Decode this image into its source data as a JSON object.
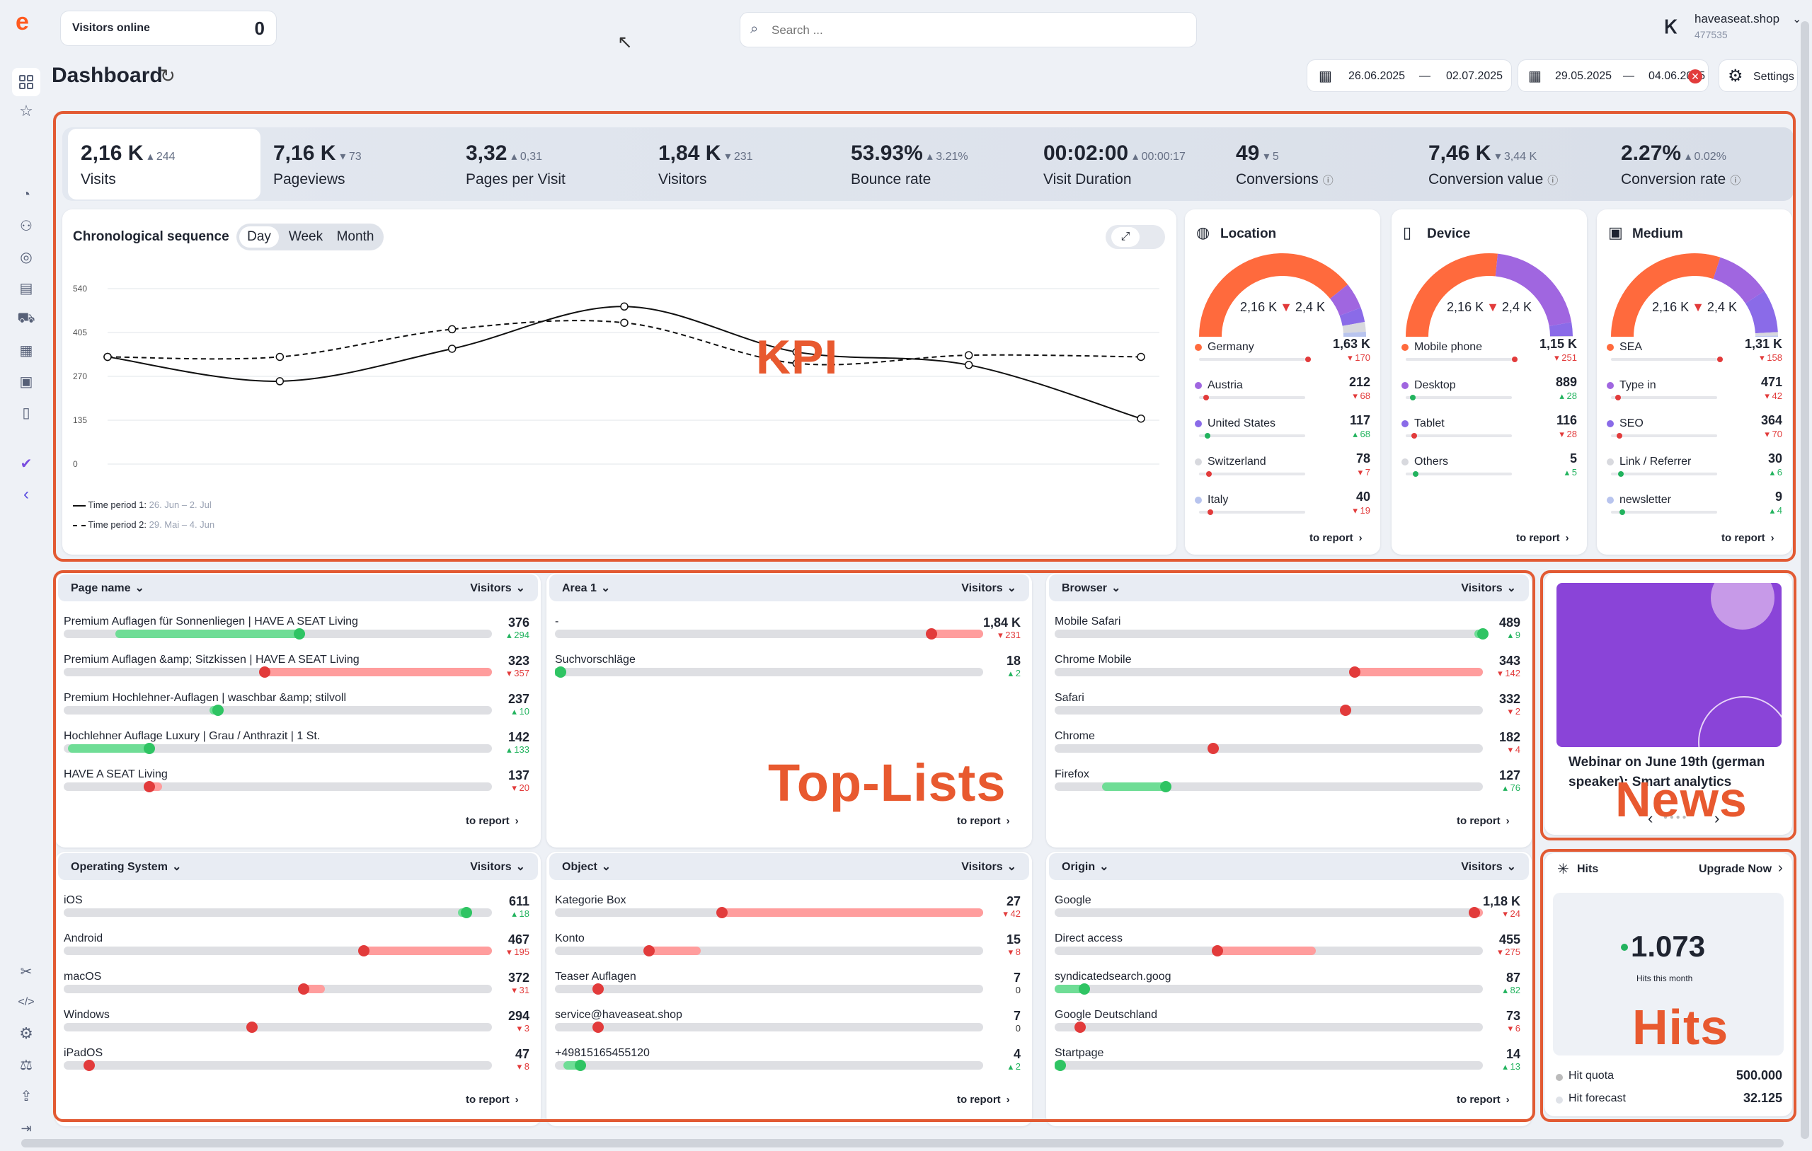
{
  "brand": {
    "logo": "e"
  },
  "header": {
    "visitors_online_label": "Visitors online",
    "visitors_online_value": "0",
    "search_placeholder": "Search ...",
    "shop_name": "haveaseat.shop",
    "shop_id": "477535",
    "title": "Dashboard",
    "period1_start": "26.06.2025",
    "period1_sep": "—",
    "period1_end": "02.07.2025",
    "period2_start": "29.05.2025",
    "period2_sep": "—",
    "period2_end": "04.06.2025",
    "settings_label": "Settings"
  },
  "kpis": [
    {
      "value": "2,16 K",
      "delta": "▴ 244",
      "dir": "up",
      "label": "Visits"
    },
    {
      "value": "7,16 K",
      "delta": "▾ 73",
      "dir": "dn",
      "label": "Pageviews"
    },
    {
      "value": "3,32",
      "delta": "▴ 0,31",
      "dir": "up",
      "label": "Pages per Visit"
    },
    {
      "value": "1,84 K",
      "delta": "▾ 231",
      "dir": "dn",
      "label": "Visitors"
    },
    {
      "value": "53.93%",
      "delta": "▴ 3.21%",
      "dir": "up",
      "label": "Bounce rate"
    },
    {
      "value": "00:02:00",
      "delta": "▴ 00:00:17",
      "dir": "up",
      "label": "Visit Duration"
    },
    {
      "value": "49",
      "delta": "▾ 5",
      "dir": "dn",
      "label": "Conversions"
    },
    {
      "value": "7,46 K",
      "delta": "▾ 3,44 K",
      "dir": "dn",
      "label": "Conversion value"
    },
    {
      "value": "2.27%",
      "delta": "▴ 0.02%",
      "dir": "up",
      "label": "Conversion rate"
    }
  ],
  "chronology": {
    "title": "Chronological sequence",
    "tabs": [
      "Day",
      "Week",
      "Month"
    ],
    "active_tab": "Day",
    "legend1": "Time period 1:",
    "legend1_range": "26. Jun – 2. Jul",
    "legend2": "Time period 2:",
    "legend2_range": "29. Mai – 4. Jun",
    "watermark": "KPI"
  },
  "chart_data": {
    "type": "line",
    "x": [
      "1",
      "2",
      "3",
      "4",
      "5",
      "6",
      "7"
    ],
    "ylim": [
      0,
      540
    ],
    "yticks": [
      "540",
      "405",
      "270",
      "135",
      "0"
    ],
    "series": [
      {
        "name": "Time period 1:",
        "style": "solid",
        "values": [
          330,
          255,
          355,
          485,
          345,
          305,
          140
        ]
      },
      {
        "name": "Time period 2:",
        "style": "dashed",
        "values": [
          330,
          330,
          415,
          435,
          310,
          335,
          330
        ]
      }
    ]
  },
  "donuts": [
    {
      "title": "Location",
      "icon": "globe-icon",
      "center": "2,16 K",
      "center_delta": "2,4 K",
      "items": [
        {
          "label": "Germany",
          "value": "1,63 K",
          "delta": "▾ 170",
          "dir": "dn",
          "color": "#ff6a3d"
        },
        {
          "label": "Austria",
          "value": "212",
          "delta": "▾ 68",
          "dir": "dn",
          "color": "#a066e0"
        },
        {
          "label": "United States",
          "value": "117",
          "delta": "▴ 68",
          "dir": "up",
          "color": "#8a6be8"
        },
        {
          "label": "Switzerland",
          "value": "78",
          "delta": "▾ 7",
          "dir": "dn",
          "color": "#d8d9de"
        },
        {
          "label": "Italy",
          "value": "40",
          "delta": "▾ 19",
          "dir": "dn",
          "color": "#b8c4ee"
        }
      ],
      "to_report": "to report"
    },
    {
      "title": "Device",
      "icon": "phone-icon",
      "center": "2,16 K",
      "center_delta": "2,4 K",
      "items": [
        {
          "label": "Mobile phone",
          "value": "1,15 K",
          "delta": "▾ 251",
          "dir": "dn",
          "color": "#ff6a3d"
        },
        {
          "label": "Desktop",
          "value": "889",
          "delta": "▴ 28",
          "dir": "up",
          "color": "#a066e0"
        },
        {
          "label": "Tablet",
          "value": "116",
          "delta": "▾ 28",
          "dir": "dn",
          "color": "#8a6be8"
        },
        {
          "label": "Others",
          "value": "5",
          "delta": "▴ 5",
          "dir": "up",
          "color": "#d8d9de"
        }
      ],
      "to_report": "to report"
    },
    {
      "title": "Medium",
      "icon": "medium-icon",
      "center": "2,16 K",
      "center_delta": "2,4 K",
      "items": [
        {
          "label": "SEA",
          "value": "1,31 K",
          "delta": "▾ 158",
          "dir": "dn",
          "color": "#ff6a3d"
        },
        {
          "label": "Type in",
          "value": "471",
          "delta": "▾ 42",
          "dir": "dn",
          "color": "#a066e0"
        },
        {
          "label": "SEO",
          "value": "364",
          "delta": "▾ 70",
          "dir": "dn",
          "color": "#8a6be8"
        },
        {
          "label": "Link / Referrer",
          "value": "30",
          "delta": "▴ 6",
          "dir": "up",
          "color": "#d8d9de"
        },
        {
          "label": "newsletter",
          "value": "9",
          "delta": "▴ 4",
          "dir": "up",
          "color": "#b8c4ee"
        }
      ],
      "to_report": "to report"
    }
  ],
  "toplists": [
    {
      "title": "Page name",
      "metric": "Visitors",
      "to_report": "to report",
      "rows": [
        {
          "name": "Premium Auflagen für Sonnenliegen | HAVE A SEAT Living",
          "value": "376",
          "delta": "▴ 294",
          "dir": "up",
          "a": 0.12,
          "b": 0.55
        },
        {
          "name": "Premium Auflagen &amp; Sitzkissen | HAVE A SEAT Living",
          "value": "323",
          "delta": "▾ 357",
          "dir": "dn",
          "a": 0.47,
          "b": 1.0
        },
        {
          "name": "Premium Hochlehner-Auflagen | waschbar &amp; stilvoll",
          "value": "237",
          "delta": "▴ 10",
          "dir": "up",
          "a": 0.34,
          "b": 0.36
        },
        {
          "name": "Hochlehner Auflage Luxury | Grau / Anthrazit | 1 St.",
          "value": "142",
          "delta": "▴ 133",
          "dir": "up",
          "a": 0.01,
          "b": 0.2
        },
        {
          "name": "HAVE A SEAT Living",
          "value": "137",
          "delta": "▾ 20",
          "dir": "dn",
          "a": 0.2,
          "b": 0.23
        }
      ]
    },
    {
      "title": "Area 1",
      "metric": "Visitors",
      "to_report": "to report",
      "rows": [
        {
          "name": "-",
          "value": "1,84 K",
          "delta": "▾ 231",
          "dir": "dn",
          "a": 0.88,
          "b": 1.0
        },
        {
          "name": "Suchvorschläge",
          "value": "18",
          "delta": "▴ 2",
          "dir": "up",
          "a": 0.0,
          "b": 0.01
        }
      ],
      "watermark": "Top-Lists"
    },
    {
      "title": "Browser",
      "metric": "Visitors",
      "to_report": "to report",
      "rows": [
        {
          "name": "Mobile Safari",
          "value": "489",
          "delta": "▴ 9",
          "dir": "up",
          "a": 0.98,
          "b": 1.0
        },
        {
          "name": "Chrome Mobile",
          "value": "343",
          "delta": "▾ 142",
          "dir": "dn",
          "a": 0.7,
          "b": 1.0
        },
        {
          "name": "Safari",
          "value": "332",
          "delta": "▾ 2",
          "dir": "dn",
          "a": 0.68,
          "b": 0.69
        },
        {
          "name": "Chrome",
          "value": "182",
          "delta": "▾ 4",
          "dir": "dn",
          "a": 0.37,
          "b": 0.38
        },
        {
          "name": "Firefox",
          "value": "127",
          "delta": "▴ 76",
          "dir": "up",
          "a": 0.11,
          "b": 0.26
        }
      ]
    },
    {
      "title": "Operating System",
      "metric": "Visitors",
      "to_report": "to report",
      "rows": [
        {
          "name": "iOS",
          "value": "611",
          "delta": "▴ 18",
          "dir": "up",
          "a": 0.92,
          "b": 0.94
        },
        {
          "name": "Android",
          "value": "467",
          "delta": "▾ 195",
          "dir": "dn",
          "a": 0.7,
          "b": 1.0
        },
        {
          "name": "macOS",
          "value": "372",
          "delta": "▾ 31",
          "dir": "dn",
          "a": 0.56,
          "b": 0.61
        },
        {
          "name": "Windows",
          "value": "294",
          "delta": "▾ 3",
          "dir": "dn",
          "a": 0.44,
          "b": 0.45
        },
        {
          "name": "iPadOS",
          "value": "47",
          "delta": "▾ 8",
          "dir": "dn",
          "a": 0.06,
          "b": 0.07
        }
      ]
    },
    {
      "title": "Object",
      "metric": "Visitors",
      "to_report": "to report",
      "rows": [
        {
          "name": "Kategorie Box",
          "value": "27",
          "delta": "▾ 42",
          "dir": "dn",
          "a": 0.39,
          "b": 1.0
        },
        {
          "name": "Konto",
          "value": "15",
          "delta": "▾ 8",
          "dir": "dn",
          "a": 0.22,
          "b": 0.34
        },
        {
          "name": "Teaser Auflagen",
          "value": "7",
          "delta": "0",
          "dir": "nc",
          "a": 0.1,
          "b": 0.11
        },
        {
          "name": "service@haveaseat.shop",
          "value": "7",
          "delta": "0",
          "dir": "nc",
          "a": 0.1,
          "b": 0.11
        },
        {
          "name": "+49815165455120",
          "value": "4",
          "delta": "▴ 2",
          "dir": "up",
          "a": 0.02,
          "b": 0.06
        }
      ]
    },
    {
      "title": "Origin",
      "metric": "Visitors",
      "to_report": "to report",
      "rows": [
        {
          "name": "Google",
          "value": "1,18 K",
          "delta": "▾ 24",
          "dir": "dn",
          "a": 0.98,
          "b": 1.0
        },
        {
          "name": "Direct access",
          "value": "455",
          "delta": "▾ 275",
          "dir": "dn",
          "a": 0.38,
          "b": 0.61
        },
        {
          "name": "syndicatedsearch.goog",
          "value": "87",
          "delta": "▴ 82",
          "dir": "up",
          "a": 0.0,
          "b": 0.07
        },
        {
          "name": "Google Deutschland",
          "value": "73",
          "delta": "▾ 6",
          "dir": "dn",
          "a": 0.06,
          "b": 0.07
        },
        {
          "name": "Startpage",
          "value": "14",
          "delta": "▴ 13",
          "dir": "up",
          "a": 0.0,
          "b": 0.01
        }
      ]
    }
  ],
  "news": {
    "text": "Webinar on June 19th (german speaker): Smart analytics",
    "watermark": "News",
    "prev": "‹",
    "next": "›"
  },
  "hits": {
    "title": "Hits",
    "upgrade": "Upgrade Now",
    "value": "1.073",
    "sub": "Hits this month",
    "watermark": "Hits",
    "quota_label": "Hit quota",
    "quota_value": "500.000",
    "forecast_label": "Hit forecast",
    "forecast_value": "32.125"
  }
}
